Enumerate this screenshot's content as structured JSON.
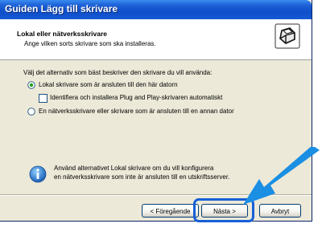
{
  "window": {
    "title": "Guiden Lägg till skrivare"
  },
  "header": {
    "title": "Lokal eller nätverksskrivare",
    "subtitle": "Ange vilken sorts skrivare som ska installeras."
  },
  "body": {
    "prompt": "Välj det alternativ som bäst beskriver den skrivare du vill använda:",
    "option_local": "Lokal skrivare som är ansluten till den här datorn",
    "option_local_selected": true,
    "checkbox_pnp": "Identifiera och installera Plug and Play-skrivaren automatiskt",
    "checkbox_pnp_checked": false,
    "option_network": "En nätverksskrivare eller skrivare som är ansluten till en annan dator",
    "info_line1": "Använd alternativet Lokal skrivare om du vill konfigurera",
    "info_line2": "en nätverksskrivare som inte är ansluten till en utskriftsserver."
  },
  "buttons": {
    "back": "< Föregående",
    "next": "Nästa >",
    "cancel": "Avbryt"
  },
  "colors": {
    "titlebar": "#0f4fc8",
    "highlight_ring": "#1560d8",
    "arrow": "#1a8fe3"
  },
  "icons": [
    "printer-icon",
    "info-icon",
    "pointer-arrow-icon"
  ]
}
